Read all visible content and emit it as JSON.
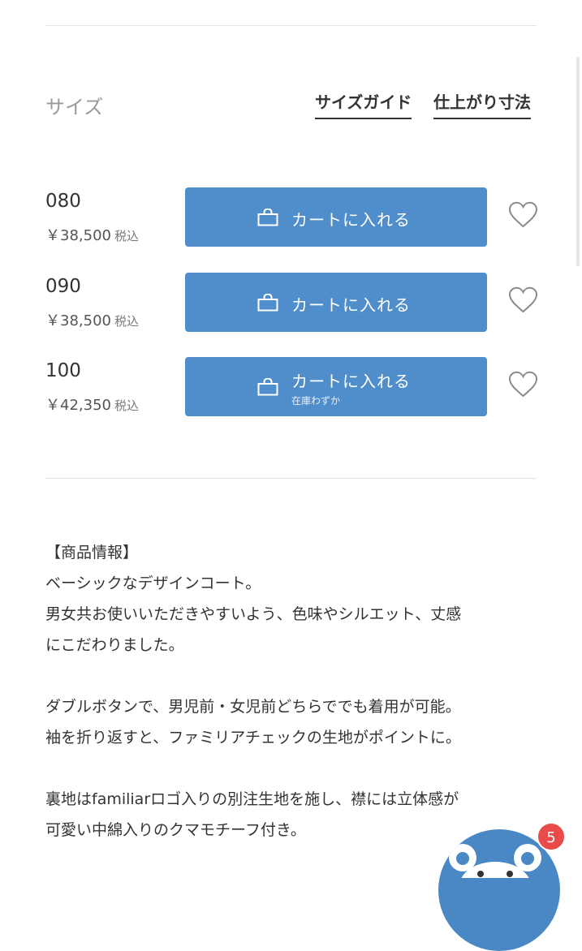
{
  "size_section": {
    "title": "サイズ",
    "size_guide_label": "サイズガイド",
    "measurements_label": "仕上がり寸法"
  },
  "sizes": [
    {
      "code": "080",
      "price": "￥38,500",
      "tax_label": "税込",
      "cart_label": "カートに入れる",
      "note": ""
    },
    {
      "code": "090",
      "price": "￥38,500",
      "tax_label": "税込",
      "cart_label": "カートに入れる",
      "note": ""
    },
    {
      "code": "100",
      "price": "￥42,350",
      "tax_label": "税込",
      "cart_label": "カートに入れる",
      "note": "在庫わずか"
    }
  ],
  "description": {
    "heading": "【商品情報】",
    "line1": "ベーシックなデザインコート。",
    "line2": "男女共お使いいただきやすいよう、色味やシルエット、丈感",
    "line3": "にこだわりました。",
    "line4": "ダブルボタンで、男児前・女児前どちらででも着用が可能。",
    "line5": "袖を折り返すと、ファミリアチェックの生地がポイントに。",
    "line6": "裏地はfamiliarロゴ入りの別注生地を施し、襟には立体感が",
    "line7": "可愛い中綿入りのクマモチーフ付き。"
  },
  "chat": {
    "badge_count": "5",
    "icon": "bear-chat-icon"
  },
  "colors": {
    "accent": "#4f8dcb",
    "badge": "#e94b4b"
  },
  "icons": {
    "cart": "shopping-bag-icon",
    "favorite": "heart-outline-icon"
  }
}
